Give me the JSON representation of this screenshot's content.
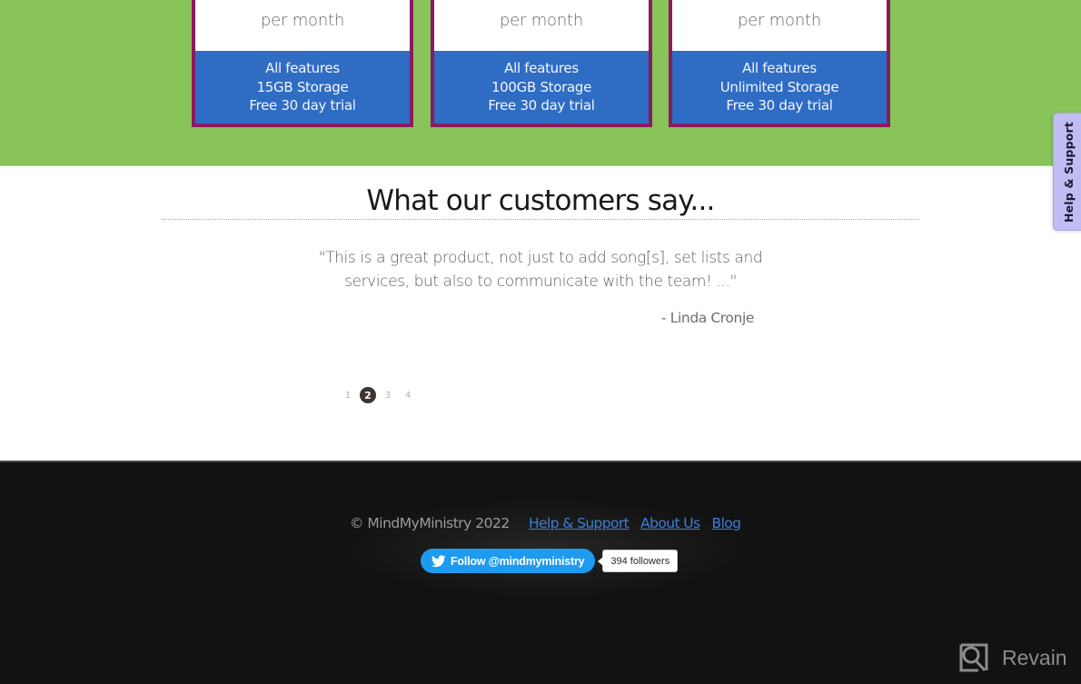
{
  "pricing": {
    "plans": [
      {
        "price_unit": "per month",
        "features": [
          "All features",
          "15GB Storage",
          "Free 30 day trial"
        ]
      },
      {
        "price_unit": "per month",
        "features": [
          "All features",
          "100GB Storage",
          "Free 30 day trial"
        ]
      },
      {
        "price_unit": "per month",
        "features": [
          "All features",
          "Unlimited Storage",
          "Free 30 day trial"
        ]
      }
    ]
  },
  "help_tab": {
    "label": "Help & Support"
  },
  "testimonials": {
    "title": "What our customers say...",
    "quote": "\"This is a great product, not just to add song[s], set lists and services, but also to communicate with the team! ...\"",
    "author": "- Linda Cronje",
    "pages": [
      "1",
      "2",
      "3",
      "4"
    ],
    "active_page": "2"
  },
  "footer": {
    "copyright": "© MindMyMinistry 2022",
    "links": [
      "Help & Support",
      "About Us",
      "Blog"
    ],
    "twitter": {
      "icon": "twitter-bird-icon",
      "follow_label": "Follow @mindmyministry",
      "followers": "394 followers"
    }
  },
  "watermark": {
    "icon": "revain-logo-icon",
    "label": "Revain"
  },
  "colors": {
    "green_band": "#88c459",
    "card_border": "#8b1a5e",
    "card_features_bg": "#2f6cc3",
    "footer_bg": "#121212",
    "link": "#3d7fd9",
    "twitter_blue": "#1d9bf0",
    "help_tab_bg": "#bfbdf4"
  }
}
